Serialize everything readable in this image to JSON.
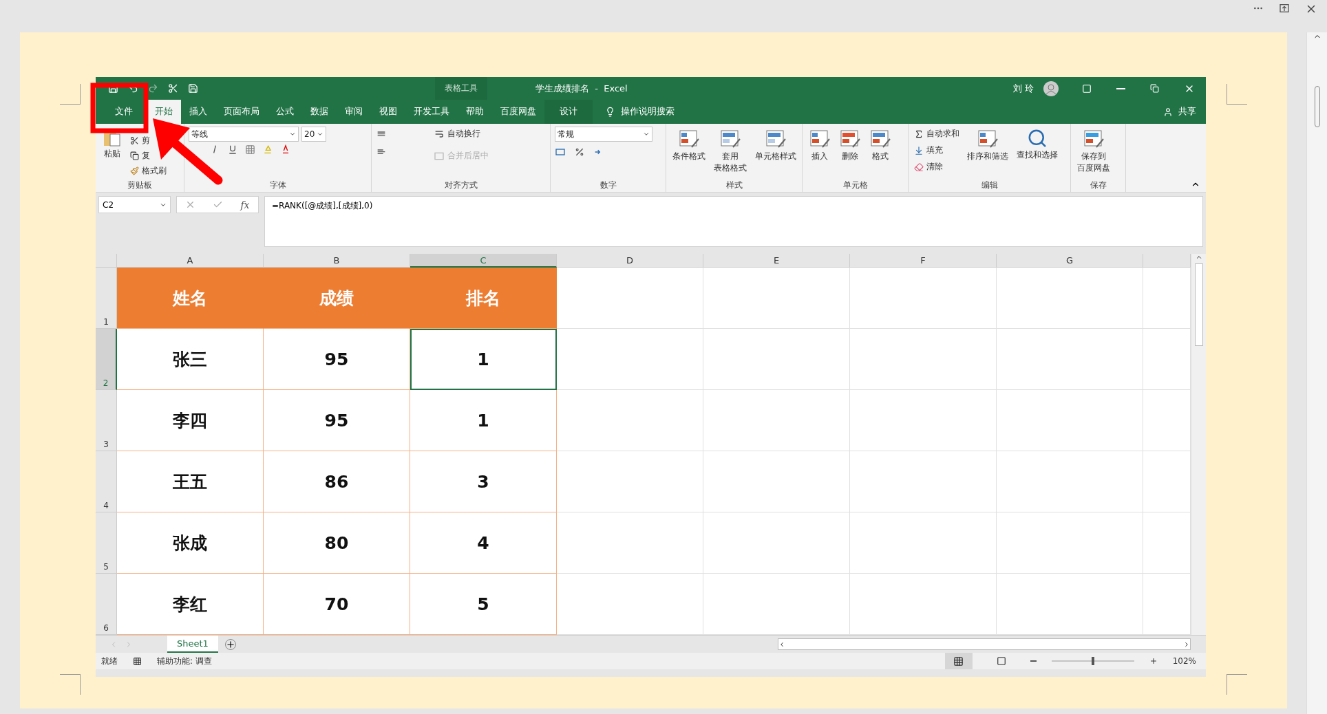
{
  "excel": {
    "title_bar": {
      "context_group": "表格工具",
      "title": "学生成绩排名  -  Excel",
      "user": "刘 玲"
    },
    "tabs": [
      {
        "label": "文件",
        "selected": false,
        "kind": "file"
      },
      {
        "label": "开始",
        "selected": true,
        "kind": "tab"
      },
      {
        "label": "插入",
        "selected": false,
        "kind": "tab"
      },
      {
        "label": "页面布局",
        "selected": false,
        "kind": "tab"
      },
      {
        "label": "公式",
        "selected": false,
        "kind": "tab"
      },
      {
        "label": "数据",
        "selected": false,
        "kind": "tab"
      },
      {
        "label": "审阅",
        "selected": false,
        "kind": "tab"
      },
      {
        "label": "视图",
        "selected": false,
        "kind": "tab"
      },
      {
        "label": "开发工具",
        "selected": false,
        "kind": "tab"
      },
      {
        "label": "帮助",
        "selected": false,
        "kind": "tab"
      },
      {
        "label": "百度网盘",
        "selected": false,
        "kind": "tab"
      },
      {
        "label": "设计",
        "selected": false,
        "kind": "context"
      }
    ],
    "tell_me": "操作说明搜索",
    "share": "共享",
    "ribbon": {
      "clipboard": {
        "paste": "粘贴",
        "items": [
          "剪",
          "复",
          "格式刷"
        ],
        "label": "剪贴板"
      },
      "font": {
        "name": "等线",
        "size": "20",
        "label": "字体"
      },
      "alignment": {
        "wrap": "自动换行",
        "merge": {
          "label": "合并后居中",
          "disabled": true
        },
        "label": "对齐方式"
      },
      "number": {
        "format": "常规",
        "label": "数字"
      },
      "styles": {
        "buttons": [
          [
            "条件格式"
          ],
          [
            "套用",
            "表格格式"
          ],
          [
            "单元格样式"
          ]
        ],
        "label": "样式"
      },
      "cells": {
        "buttons": [
          "插入",
          "删除",
          "格式"
        ],
        "label": "单元格"
      },
      "editing": {
        "items": [
          "自动求和",
          "填充",
          "清除"
        ],
        "buttons": [
          "排序和筛选",
          "查找和选择"
        ],
        "label": "编辑"
      },
      "save": {
        "button": [
          "保存到",
          "百度网盘"
        ],
        "label": "保存"
      }
    },
    "formula_bar": {
      "name_box": "C2",
      "fx": "fx",
      "formula": "=RANK([@成绩],[成绩],0)"
    },
    "columns": [
      {
        "label": "A",
        "selected": false
      },
      {
        "label": "B",
        "selected": false
      },
      {
        "label": "C",
        "selected": true
      },
      {
        "label": "D",
        "selected": false
      },
      {
        "label": "E",
        "selected": false
      },
      {
        "label": "F",
        "selected": false
      },
      {
        "label": "G",
        "selected": false
      }
    ],
    "rows": [
      {
        "number": "1",
        "selected": false,
        "kind": "header",
        "cells": [
          "姓名",
          "成绩",
          "排名"
        ]
      },
      {
        "number": "2",
        "selected": true,
        "kind": "data",
        "cells": [
          "张三",
          "95",
          "1"
        ]
      },
      {
        "number": "3",
        "selected": false,
        "kind": "data",
        "cells": [
          "李四",
          "95",
          "1"
        ]
      },
      {
        "number": "4",
        "selected": false,
        "kind": "data",
        "cells": [
          "王五",
          "86",
          "3"
        ]
      },
      {
        "number": "5",
        "selected": false,
        "kind": "data",
        "cells": [
          "张成",
          "80",
          "4"
        ]
      },
      {
        "number": "6",
        "selected": false,
        "kind": "data",
        "cells": [
          "李红",
          "70",
          "5"
        ]
      }
    ],
    "sheets": [
      {
        "label": "Sheet1",
        "selected": true
      }
    ],
    "status_bar": {
      "ready": "就绪",
      "accessibility": "辅助功能: 调查",
      "zoom_slider": {
        "level": 0.5
      },
      "zoom": "102%"
    }
  }
}
